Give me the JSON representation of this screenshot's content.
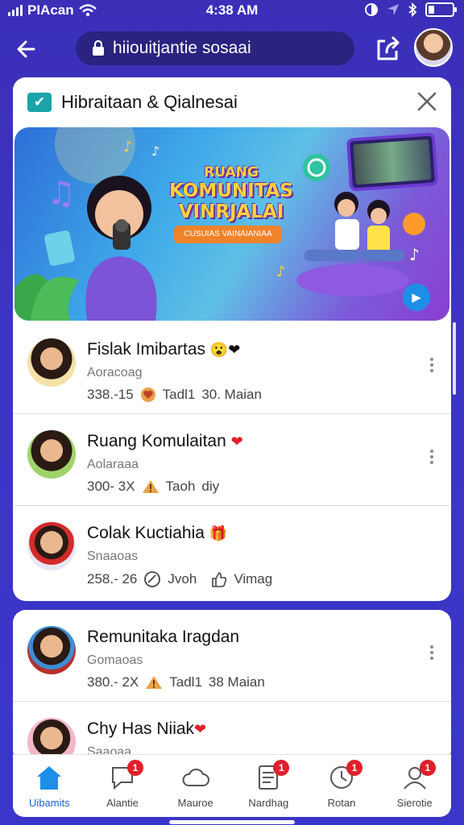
{
  "status": {
    "carrier": "PIAcan",
    "time": "4:38 AM",
    "icons": [
      "signal-icon",
      "wifi-icon",
      "moon-icon",
      "location-icon",
      "bluetooth-icon",
      "battery-icon"
    ]
  },
  "nav": {
    "url": "hiiouitjantie sosaai",
    "icons": [
      "back-arrow-icon",
      "lock-icon",
      "share-icon",
      "avatar"
    ]
  },
  "card": {
    "title": "Hibraitaan & Qialnesai",
    "icons": [
      "checkbox-icon",
      "close-icon"
    ],
    "banner": {
      "line1": "RUANG",
      "line2": "KOMUNITAS",
      "line3": "VINRJALAI",
      "subtitle": "CUSUIAS VAINAIANIAA"
    }
  },
  "list": [
    {
      "name": "Fislak Imibartas",
      "emoji": "😮❤",
      "sub": "Aoracoag",
      "count": "338.-15",
      "meta1": "Tadl1",
      "meta2": "30. Maian",
      "icon": "heart-badge-icon"
    },
    {
      "name": "Ruang Komulaitan",
      "emoji": "❤",
      "sub": "Aolaraaa",
      "count": "300- 3X",
      "meta1": "Taoh",
      "meta2": "diy",
      "icon": "warning-icon"
    },
    {
      "name": "Colak Kuctiahia",
      "emoji": "🎁",
      "sub": "Snaaoas",
      "count": "258.- 26",
      "meta1": "Jvoh",
      "meta2": "Vimag",
      "icon": "search-icon"
    }
  ],
  "list2": [
    {
      "name": "Remunitaka Iragdan",
      "sub": "Gomaoas",
      "count": "380.- 2X",
      "meta1": "Tadl1",
      "meta2": "38 Maian"
    },
    {
      "name": "Chy Has Niiak",
      "emoji": "❤",
      "sub": "Saaoaa"
    }
  ],
  "tabs": [
    {
      "label": "Uibamits",
      "icon": "home-icon",
      "badge": ""
    },
    {
      "label": "Alantie",
      "icon": "chat-bubble-icon",
      "badge": "1"
    },
    {
      "label": "Mauroe",
      "icon": "cloud-icon",
      "badge": ""
    },
    {
      "label": "Nardhag",
      "icon": "document-icon",
      "badge": "1"
    },
    {
      "label": "Rotan",
      "icon": "clock-icon",
      "badge": "1"
    },
    {
      "label": "Sierotie",
      "icon": "profile-icon",
      "badge": "1"
    }
  ],
  "colors": {
    "accent": "#1c5fd8",
    "background": "#3b2fb8",
    "badge": "#e0202a",
    "teal": "#1aa3a8"
  }
}
